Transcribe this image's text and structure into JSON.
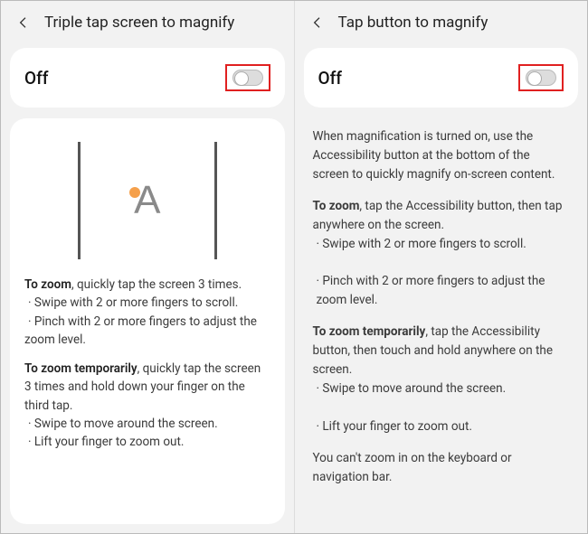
{
  "left": {
    "title": "Triple tap screen to magnify",
    "toggle_state": "Off",
    "illustration_letter": "A",
    "zoom_label": "To zoom",
    "zoom_text": ", quickly tap the screen 3 times.",
    "zoom_b1": "· Swipe with 2 or more fingers to scroll.",
    "zoom_b2": "· Pinch with 2 or more fingers to adjust the zoom level.",
    "temp_label": "To zoom temporarily",
    "temp_text": ", quickly tap the screen 3 times and hold down your finger on the third tap.",
    "temp_b1": "· Swipe to move around the screen.",
    "temp_b2": "· Lift your finger to zoom out."
  },
  "right": {
    "title": "Tap button to magnify",
    "toggle_state": "Off",
    "intro": "When magnification is turned on, use the Accessibility button at the bottom of the screen to quickly magnify on-screen content.",
    "zoom_label": "To zoom",
    "zoom_text": ", tap the Accessibility button, then tap anywhere on the screen.",
    "zoom_b1": "· Swipe with 2 or more fingers to scroll.",
    "zoom_b2": "· Pinch with 2 or more fingers to adjust the zoom level.",
    "temp_label": "To zoom temporarily",
    "temp_text": ", tap the Accessibility button, then touch and hold anywhere on the screen.",
    "temp_b1": "· Swipe to move around the screen.",
    "temp_b2": "· Lift your finger to zoom out.",
    "footer": "You can't zoom in on the keyboard or navigation bar."
  }
}
